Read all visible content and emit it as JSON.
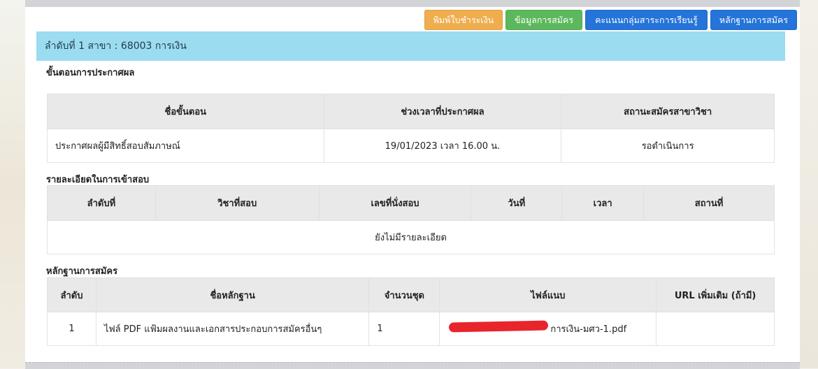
{
  "buttons": {
    "print_payment": "พิมพ์ใบชำระเงิน",
    "application_info": "ข้อมูลการสมัคร",
    "score_group": "คะแนนกลุ่มสาระการเรียนรู้",
    "evidence": "หลักฐานการสมัคร"
  },
  "info_bar": "ลำดับที่ 1 สาขา : 68003 การเงิน",
  "announcement": {
    "title": "ขั้นตอนการประกาศผล",
    "headers": [
      "ชื่อขั้นตอน",
      "ช่วงเวลาที่ประกาศผล",
      "สถานะสมัครสาขาวิชา"
    ],
    "rows": [
      [
        "ประกาศผลผู้มีสิทธิ์สอบสัมภาษณ์",
        "19/01/2023 เวลา 16.00 น.",
        "รอดำเนินการ"
      ]
    ]
  },
  "exam": {
    "title": "รายละเอียดในการเข้าสอบ",
    "headers": [
      "ลำดับที่",
      "วิชาที่สอบ",
      "เลขที่นั่งสอบ",
      "วันที่",
      "เวลา",
      "สถานที่"
    ],
    "empty_text": "ยังไม่มีรายละเอียด"
  },
  "evidence": {
    "title": "หลักฐานการสมัคร",
    "headers": [
      "ลำดับ",
      "ชื่อหลักฐาน",
      "จำนวนชุด",
      "ไฟล์แนบ",
      "URL เพิ่มเติม (ถ้ามี)"
    ],
    "rows": [
      [
        "1",
        "ไฟล์ PDF แฟ้มผลงานและเอกสารประกอบการสมัครอื่นๆ",
        "1",
        "การเงิน-มศว-1.pdf",
        ""
      ]
    ]
  },
  "colors": {
    "info_bar": "#9bdcf0",
    "orange": "#f0ad4e",
    "green": "#5cb85c",
    "blue": "#2474d9",
    "header_bg": "#e9e9e9",
    "redaction": "#e8252b"
  }
}
